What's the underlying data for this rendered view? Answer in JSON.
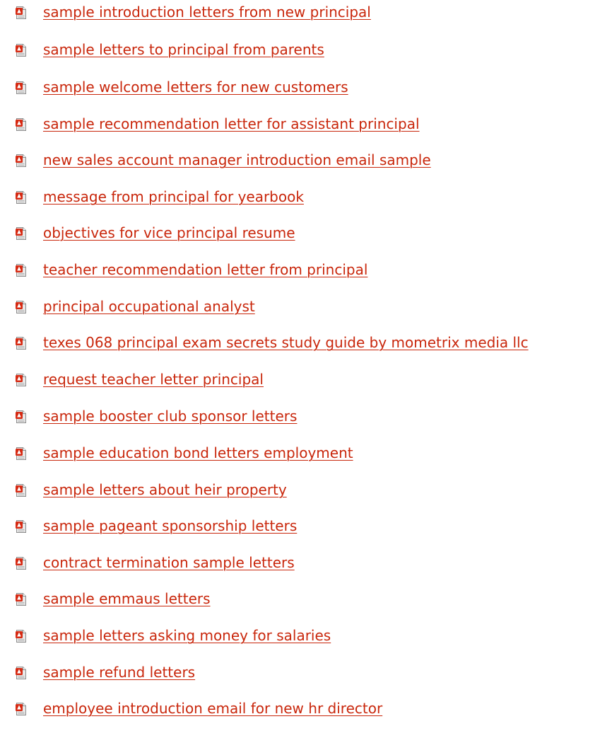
{
  "links": [
    {
      "icon": "pdf-file-icon",
      "label": "sample introduction letters from new principal"
    },
    {
      "icon": "pdf-file-icon",
      "label": "sample letters to principal from parents"
    },
    {
      "icon": "pdf-file-icon",
      "label": "sample welcome letters for new customers"
    },
    {
      "icon": "pdf-file-icon",
      "label": "sample recommendation letter for assistant principal"
    },
    {
      "icon": "pdf-file-icon",
      "label": "new sales account manager introduction email sample"
    },
    {
      "icon": "pdf-file-icon",
      "label": "message from principal for yearbook"
    },
    {
      "icon": "pdf-file-icon",
      "label": "objectives for vice principal resume"
    },
    {
      "icon": "pdf-file-icon",
      "label": "teacher recommendation letter from principal"
    },
    {
      "icon": "pdf-file-icon",
      "label": "principal occupational analyst"
    },
    {
      "icon": "pdf-file-icon",
      "label": "texes 068 principal exam secrets study guide by mometrix media llc"
    },
    {
      "icon": "pdf-file-icon",
      "label": "request teacher letter principal"
    },
    {
      "icon": "pdf-file-icon",
      "label": "sample booster club sponsor letters"
    },
    {
      "icon": "pdf-file-icon",
      "label": "sample education bond letters employment"
    },
    {
      "icon": "pdf-file-icon",
      "label": "sample letters about heir property"
    },
    {
      "icon": "pdf-file-icon",
      "label": "sample pageant sponsorship letters"
    },
    {
      "icon": "pdf-file-icon",
      "label": "contract termination sample letters"
    },
    {
      "icon": "pdf-file-icon",
      "label": "sample emmaus letters"
    },
    {
      "icon": "pdf-file-icon",
      "label": "sample letters asking money for salaries"
    },
    {
      "icon": "pdf-file-icon",
      "label": "sample refund letters"
    },
    {
      "icon": "pdf-file-icon",
      "label": "employee introduction email for new hr director"
    }
  ],
  "colors": {
    "link": "#c9270c",
    "icon_red": "#d62a13",
    "icon_paper": "#e9e9e9",
    "icon_border": "#8c8c8c"
  }
}
